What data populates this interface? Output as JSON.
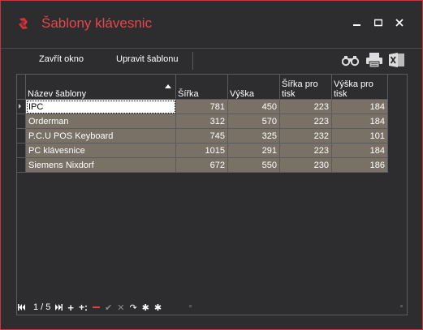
{
  "window": {
    "title": "Šablony klávesnic",
    "accent": "#e8454b",
    "buttons": {
      "minimize": "‗",
      "restore": "▭",
      "close": "✕"
    }
  },
  "toolbar": {
    "close_label": "Zavřít okno",
    "edit_label": "Upravit šablonu",
    "icons": [
      "binoculars-icon",
      "printer-icon",
      "excel-icon"
    ]
  },
  "grid": {
    "columns": [
      "Název šablony",
      "Šířka",
      "Výška",
      "Šířka pro tisk",
      "Výška pro tisk"
    ],
    "sort": {
      "column": "Název šablony",
      "direction": "ascending"
    },
    "rows": [
      [
        "IPC",
        "781",
        "450",
        "223",
        "184"
      ],
      [
        "Orderman",
        "312",
        "570",
        "223",
        "184"
      ],
      [
        "P.C.U POS Keyboard",
        "745",
        "325",
        "232",
        "101"
      ],
      [
        "PC klávesnice",
        "1015",
        "291",
        "223",
        "184"
      ],
      [
        "Siemens Nixdorf",
        "672",
        "550",
        "230",
        "186"
      ]
    ]
  },
  "navigator": {
    "position": "1 / 5",
    "first": "⏮",
    "prev": "",
    "next": "⏭",
    "add": "+",
    "insert": "+:",
    "remove": "—",
    "confirm": "✔",
    "cancel": "✕",
    "refresh": "↷",
    "filter": "✱",
    "clear_filter": "✱"
  }
}
